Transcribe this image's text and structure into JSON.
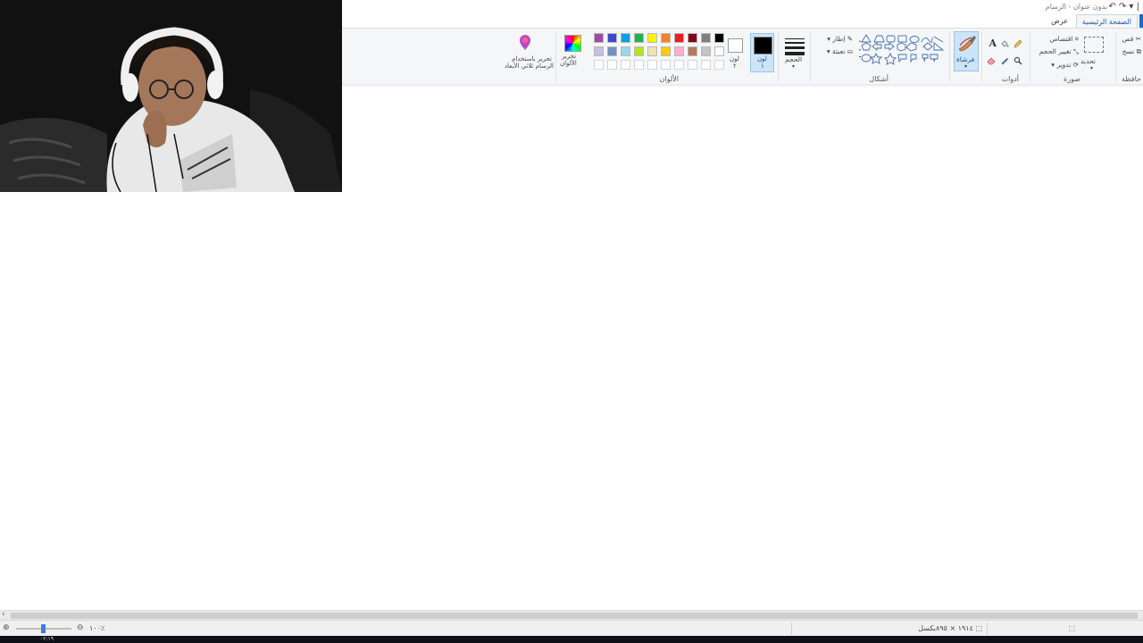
{
  "window": {
    "title": "بدون عنوان - الرسام",
    "quick_access": "↶ ↷ ▾ |"
  },
  "tabs": [
    {
      "label": "الصفحة الرئيسية",
      "active": true
    },
    {
      "label": "عرض",
      "active": false
    }
  ],
  "ribbon": {
    "clipboard": {
      "label": "حافظة",
      "cut": "قص",
      "copy": "نسخ"
    },
    "image": {
      "label": "صورة",
      "select": "تحديد",
      "crop": "اقتصاص",
      "resize": "تغيير الحجم",
      "rotate": "تدوير"
    },
    "tools": {
      "label": "أدوات"
    },
    "brushes": {
      "label": "فرشاة"
    },
    "shapes": {
      "label": "أشكال",
      "outline": "إطار",
      "fill": "تعبئة"
    },
    "size": {
      "label": "الحجم"
    },
    "color1": {
      "label": "لون",
      "num": "١"
    },
    "color2": {
      "label": "لون",
      "num": "٢"
    },
    "colors": {
      "label": "الألوان",
      "edit_label_1": "تحرير",
      "edit_label_2": "الألوان",
      "row1": [
        "#000000",
        "#7f7f7f",
        "#880015",
        "#ed1c24",
        "#ff7f27",
        "#fff200",
        "#22b14c",
        "#00a2e8",
        "#3f48cc",
        "#a349a4"
      ],
      "row2": [
        "#ffffff",
        "#c3c3c3",
        "#b97a57",
        "#ffaec9",
        "#ffc90e",
        "#efe4b0",
        "#b5e61d",
        "#99d9ea",
        "#7092be",
        "#c8bfe7"
      ]
    },
    "paint3d": {
      "line1": "تحرير باستخدام",
      "line2": "الرسام ثلاثي الأبعاد"
    }
  },
  "status": {
    "dimensions": "١٩١٤ × ٨٩٥بكسل",
    "zoom": "١٠٠٪",
    "time": "٠٢:١٩"
  },
  "colors": {
    "accent": "#1b6ac9",
    "ribbon_bg": "#f5f6f7",
    "selected_bg": "#cce4f7"
  }
}
